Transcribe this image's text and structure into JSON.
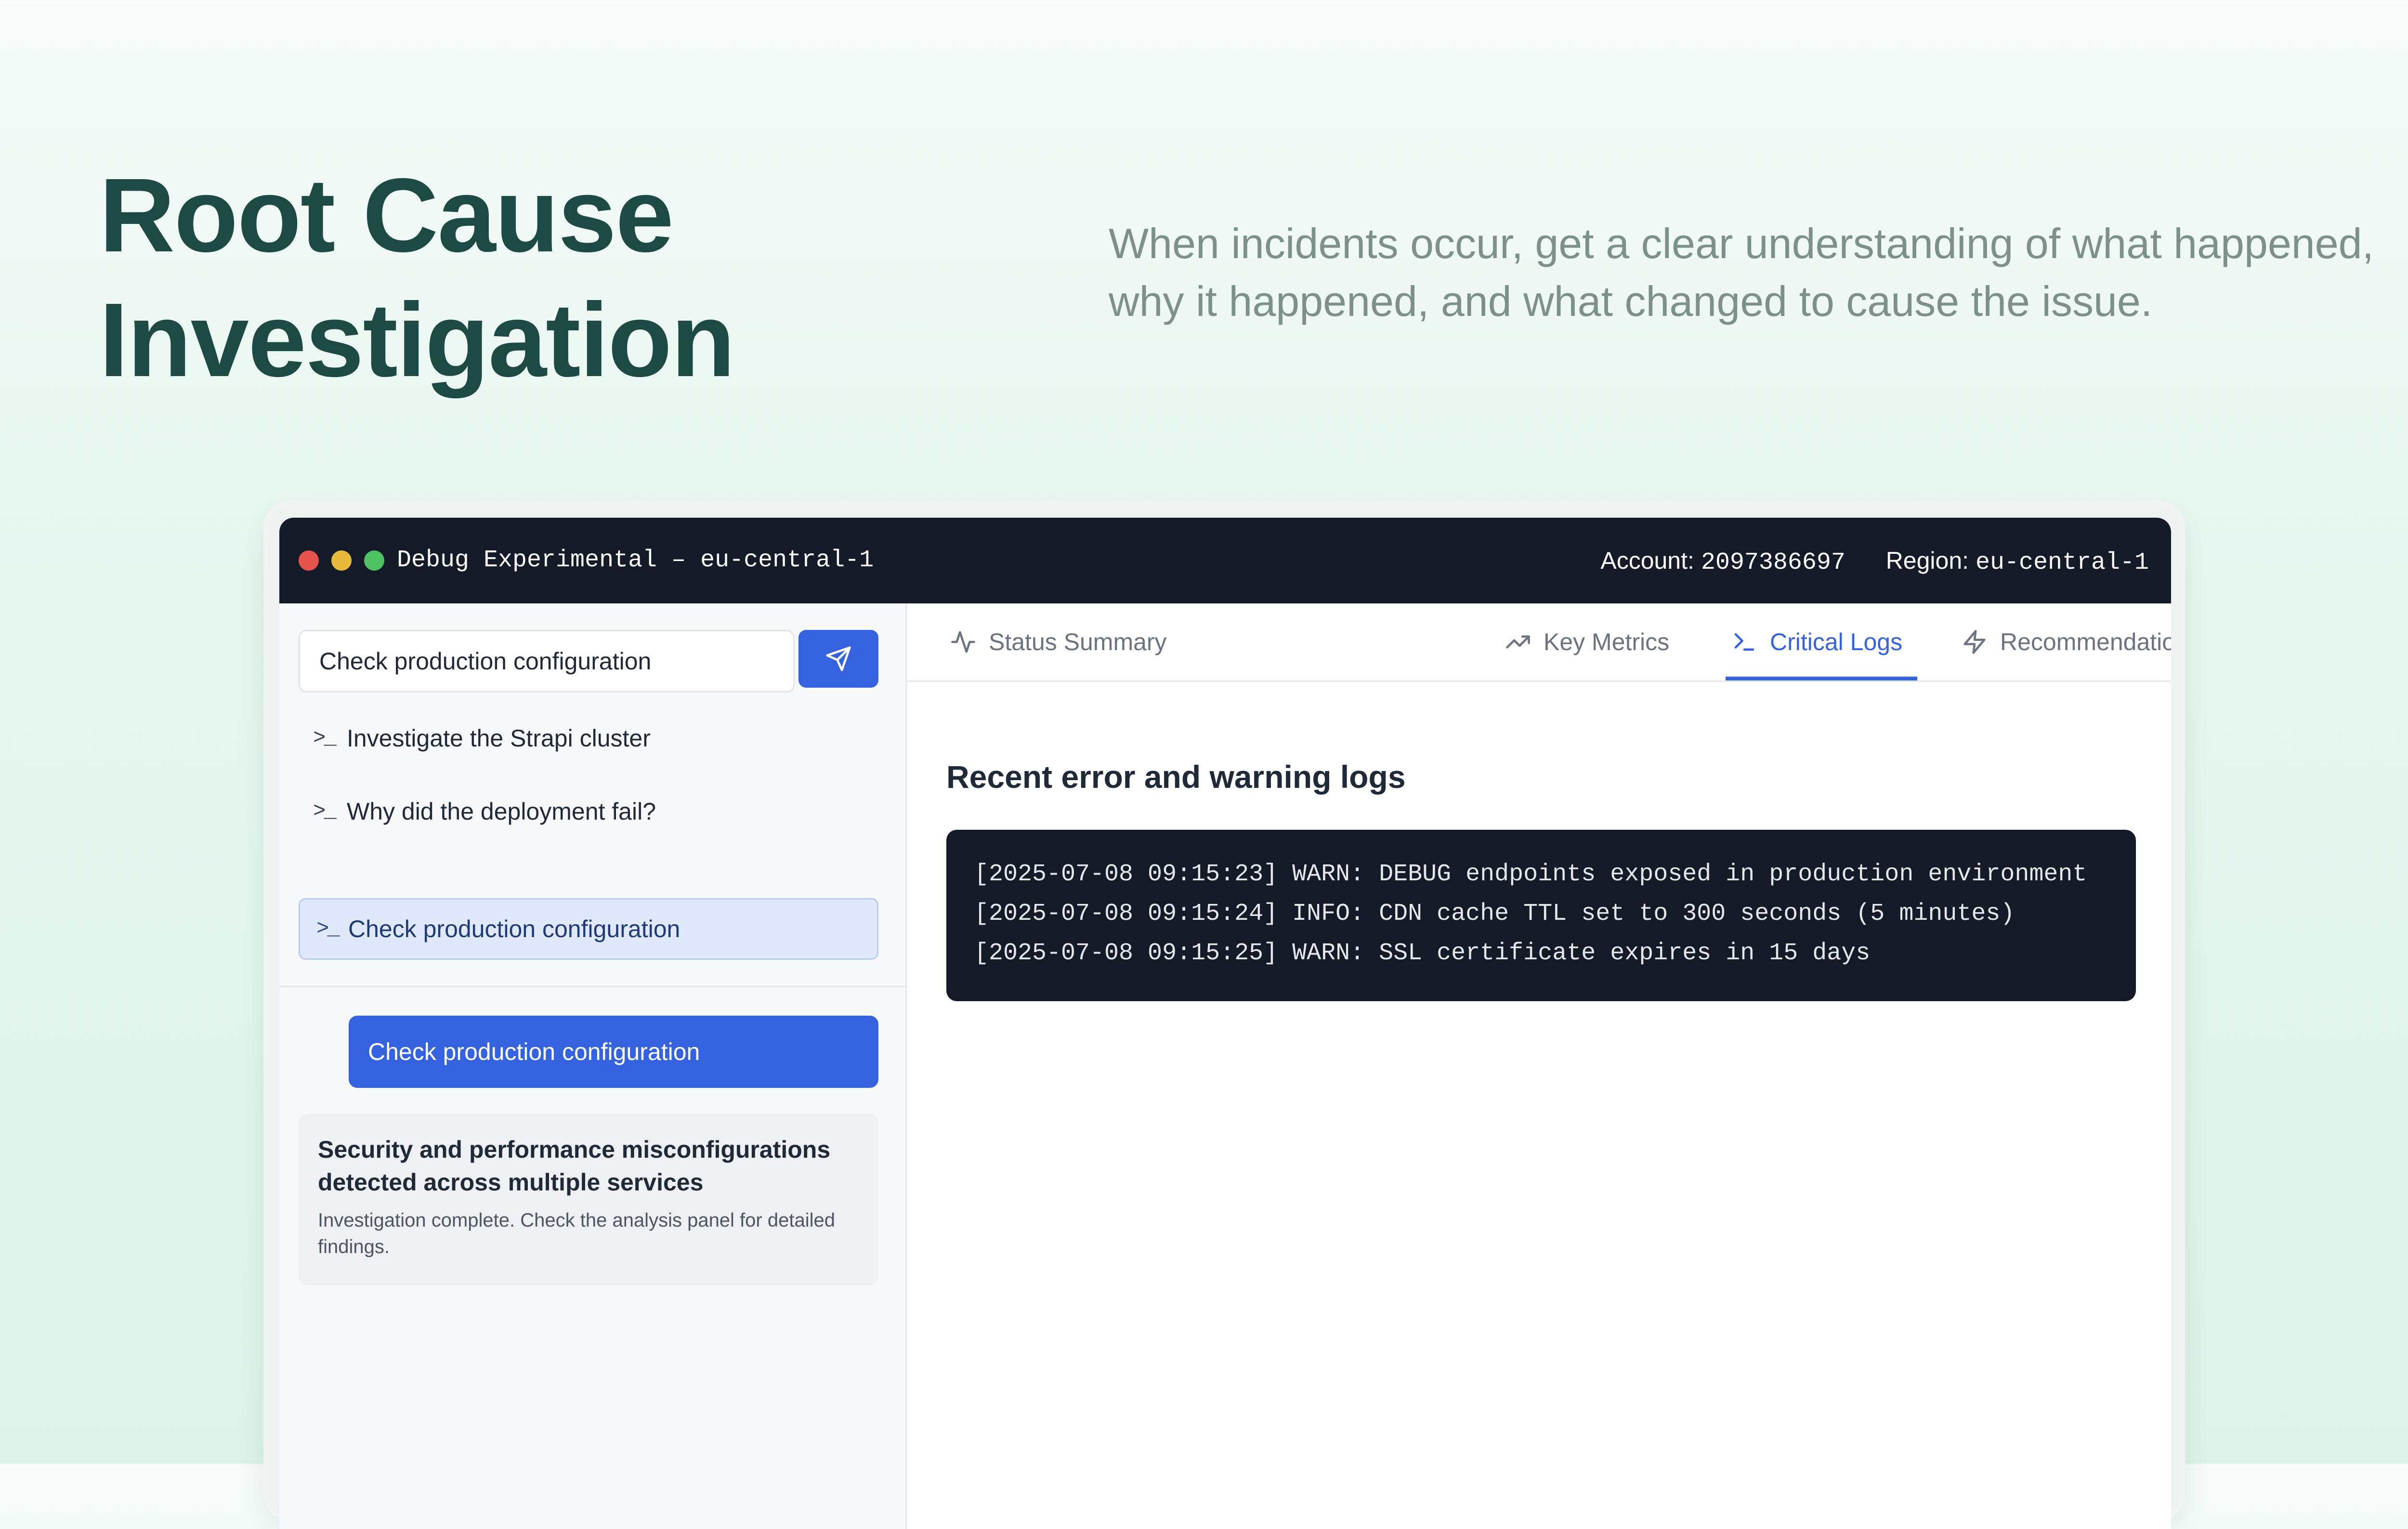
{
  "hero": {
    "title_line1": "Root Cause",
    "title_line2": "Investigation",
    "subtitle": "When incidents occur, get a clear understanding of what happened, why it happened, and what changed to cause the issue."
  },
  "window": {
    "title": "Debug Experimental – eu-central-1",
    "account_label": "Account:",
    "account_value": "2097386697",
    "region_label": "Region:",
    "region_value": "eu-central-1"
  },
  "sidebar": {
    "query_value": "Check production configuration",
    "send_icon": "send-icon",
    "suggestions": [
      {
        "label": "Investigate the Strapi cluster",
        "icon": "terminal-prompt-icon",
        "active": false
      },
      {
        "label": "Why did the deployment fail?",
        "icon": "terminal-prompt-icon",
        "active": false
      },
      {
        "label": "Check production configuration",
        "icon": "terminal-prompt-icon",
        "active": true
      }
    ],
    "user_message": "Check production configuration",
    "response": {
      "title": "Security and performance misconfigurations detected across multiple services",
      "body": "Investigation complete. Check the analysis panel for detailed findings."
    }
  },
  "tabs": [
    {
      "label": "Status Summary",
      "icon": "activity-icon",
      "active": false
    },
    {
      "label": "Key Metrics",
      "icon": "trending-up-icon",
      "active": false
    },
    {
      "label": "Critical Logs",
      "icon": "terminal-icon",
      "active": true
    },
    {
      "label": "Recommendations",
      "icon": "zap-icon",
      "active": false
    }
  ],
  "panel": {
    "heading": "Recent error and warning logs",
    "logs": [
      "[2025-07-08 09:15:23] WARN: DEBUG endpoints exposed in production environment",
      "[2025-07-08 09:15:24] INFO: CDN cache TTL set to 300 seconds (5 minutes)",
      "[2025-07-08 09:15:25] WARN: SSL certificate expires in 15 days"
    ]
  },
  "colors": {
    "accent": "#3563e0",
    "headline": "#1d4a42",
    "titlebar": "#141a28",
    "dot_red": "#e5534b",
    "dot_yellow": "#e8b93a",
    "dot_green": "#4ec163"
  }
}
